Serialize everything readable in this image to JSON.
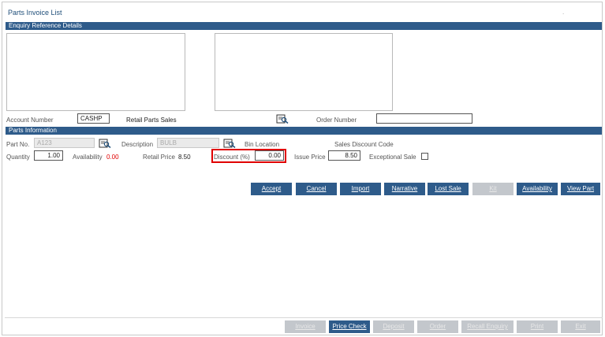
{
  "window": {
    "title": "Parts Invoice List",
    "title_dot": "."
  },
  "enquiry": {
    "section_title": "Enquiry Reference Details",
    "account_number_label": "Account Number",
    "account_number_value": "CASHP",
    "account_name": "Retail Parts Sales",
    "order_number_label": "Order Number",
    "order_number_value": ""
  },
  "parts": {
    "section_title": "Parts Information",
    "part_no_label": "Part No.",
    "part_no_value": "A123",
    "description_label": "Description",
    "description_value": "BULB",
    "bin_location_label": "Bin Location",
    "sales_discount_code_label": "Sales Discount Code",
    "quantity_label": "Quantity",
    "quantity_value": "1.00",
    "availability_label": "Availability",
    "availability_value": "0.00",
    "retail_price_label": "Retail Price",
    "retail_price_value": "8.50",
    "discount_label": "Discount (%)",
    "discount_value": "0.00",
    "issue_price_label": "Issue Price",
    "issue_price_value": "8.50",
    "exceptional_sale_label": "Exceptional Sale"
  },
  "action_buttons": {
    "accept": "Accept",
    "cancel": "Cancel",
    "import": "Import",
    "narrative": "Narrative",
    "lost_sale": "Lost Sale",
    "kit": "Kit",
    "availability": "Availability",
    "view_part": "View Part"
  },
  "footer_buttons": {
    "invoice": "Invoice",
    "price_check": "Price Check",
    "deposit": "Deposit",
    "order": "Order",
    "recall_enquiry": "Recall Enquiry",
    "print": "Print",
    "exit": "Exit"
  },
  "colors": {
    "accent": "#2e5b8a",
    "highlight": "#e00000",
    "disabled": "#c3c7cc"
  },
  "icons": {
    "lookup": "lookup-icon"
  }
}
